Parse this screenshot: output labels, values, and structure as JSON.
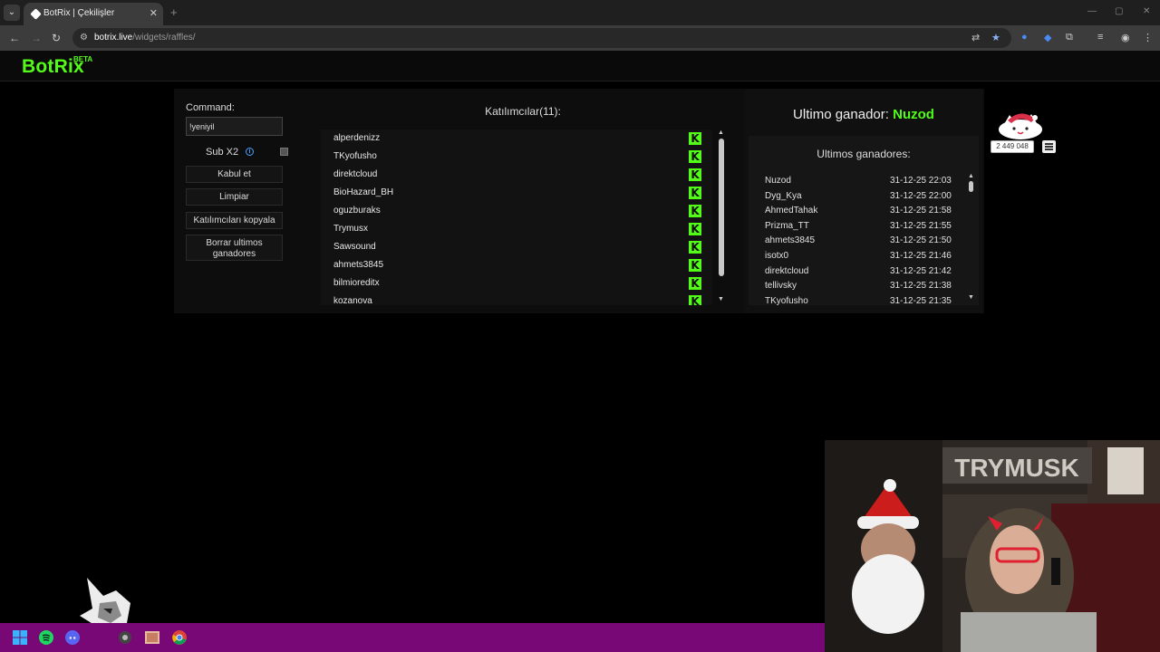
{
  "browser": {
    "tab_title": "BotRix | Çekilişler",
    "tab_close": "✕",
    "new_tab": "+",
    "url_domain": "botrix.live",
    "url_path": "/widgets/raffles/"
  },
  "header": {
    "logo": "BotRix",
    "badge": "BETA"
  },
  "controls": {
    "command_label": "Command:",
    "command_value": "!yeniyil",
    "sub_label": "Sub X2",
    "sub_checked": false,
    "accept_label": "Kabul et",
    "clear_label": "Limpiar",
    "copy_label": "Katılımcıları kopyala",
    "erase_winners_label": "Borrar ultimos ganadores"
  },
  "participants": {
    "title": "Katılımcılar(11):",
    "items": [
      "alperdenizz",
      "TKyofusho",
      "direktcloud",
      "BioHazard_BH",
      "oguzburaks",
      "Trymusx",
      "Sawsound",
      "ahmets3845",
      "bilmioreditx",
      "kozanova"
    ]
  },
  "winners": {
    "last_label": "Ultimo ganador:",
    "last_name": "Nuzod",
    "list_title": "Ultimos ganadores:",
    "items": [
      {
        "name": "Nuzod",
        "date": "31-12-25 22:03"
      },
      {
        "name": "Dyg_Kya",
        "date": "31-12-25 22:00"
      },
      {
        "name": "AhmedTahak",
        "date": "31-12-25 21:58"
      },
      {
        "name": "Prizma_TT",
        "date": "31-12-25 21:55"
      },
      {
        "name": "ahmets3845",
        "date": "31-12-25 21:50"
      },
      {
        "name": "isotx0",
        "date": "31-12-25 21:46"
      },
      {
        "name": "direktcloud",
        "date": "31-12-25 21:42"
      },
      {
        "name": "tellivsky",
        "date": "31-12-25 21:38"
      },
      {
        "name": "TKyofusho",
        "date": "31-12-25 21:35"
      }
    ]
  },
  "points_widget": {
    "points": "2 449 048"
  },
  "webcam": {
    "sign_text": "TRYMUSK"
  },
  "colors": {
    "accent": "#53fc18",
    "taskbar": "#780876",
    "background": "#000000"
  }
}
